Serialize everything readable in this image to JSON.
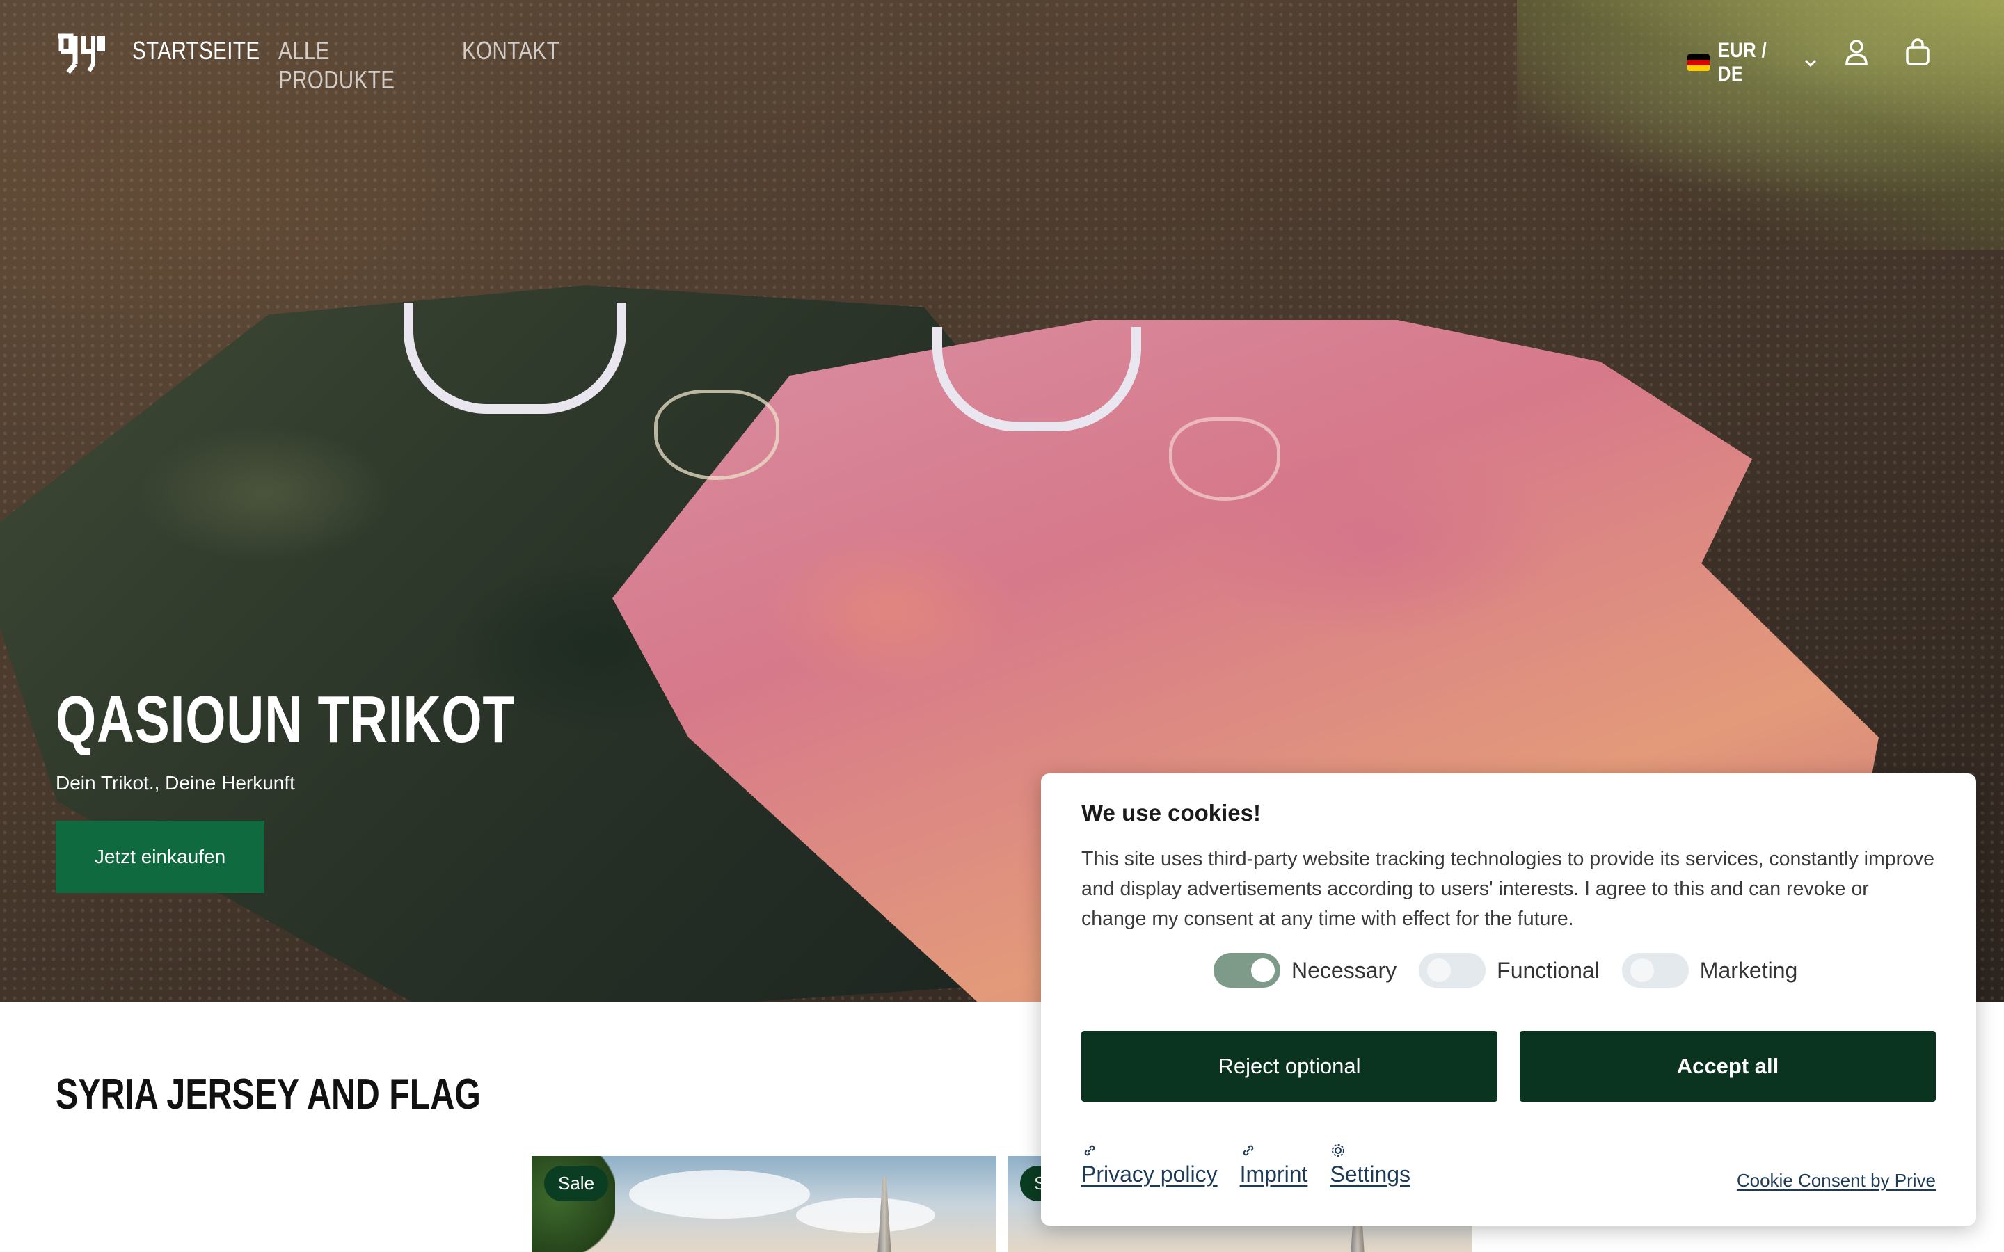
{
  "header": {
    "nav": [
      {
        "label": "STARTSEITE"
      },
      {
        "label": "ALLE PRODUKTE"
      },
      {
        "label": "KONTAKT"
      }
    ],
    "locale": "EUR / DE",
    "icons": [
      "logo",
      "flag-de-icon",
      "chevron-down-icon",
      "user-icon",
      "shopping-bag-icon"
    ]
  },
  "hero": {
    "title": "QASIOUN TRIKOT",
    "subtitle": "Dein Trikot., Deine Herkunft",
    "cta": "Jetzt einkaufen"
  },
  "section": {
    "title": "SYRIA JERSEY AND FLAG",
    "products": [
      {
        "badge": "Sale"
      },
      {
        "badge": "Sale"
      }
    ]
  },
  "cookie": {
    "title": "We use cookies!",
    "text": "This site uses third-party website tracking technologies to provide its services, constantly improve and display advertisements according to users' interests. I agree to this and can revoke or change my consent at any time with effect for the future.",
    "toggles": [
      {
        "label": "Necessary",
        "checked": true
      },
      {
        "label": "Functional",
        "checked": false
      },
      {
        "label": "Marketing",
        "checked": false
      }
    ],
    "reject": "Reject optional",
    "accept": "Accept all",
    "links": [
      {
        "label": "Privacy policy",
        "icon": "link-icon"
      },
      {
        "label": "Imprint",
        "icon": "link-icon"
      },
      {
        "label": "Settings",
        "icon": "gear-icon"
      }
    ],
    "brand": "Cookie Consent by Prive"
  },
  "colors": {
    "cta_green": "#0f6a3f",
    "cookie_button": "#0a3320",
    "sale_badge": "#0a3d22",
    "toggle_on": "#7e9a88",
    "link": "#1d3a57"
  }
}
